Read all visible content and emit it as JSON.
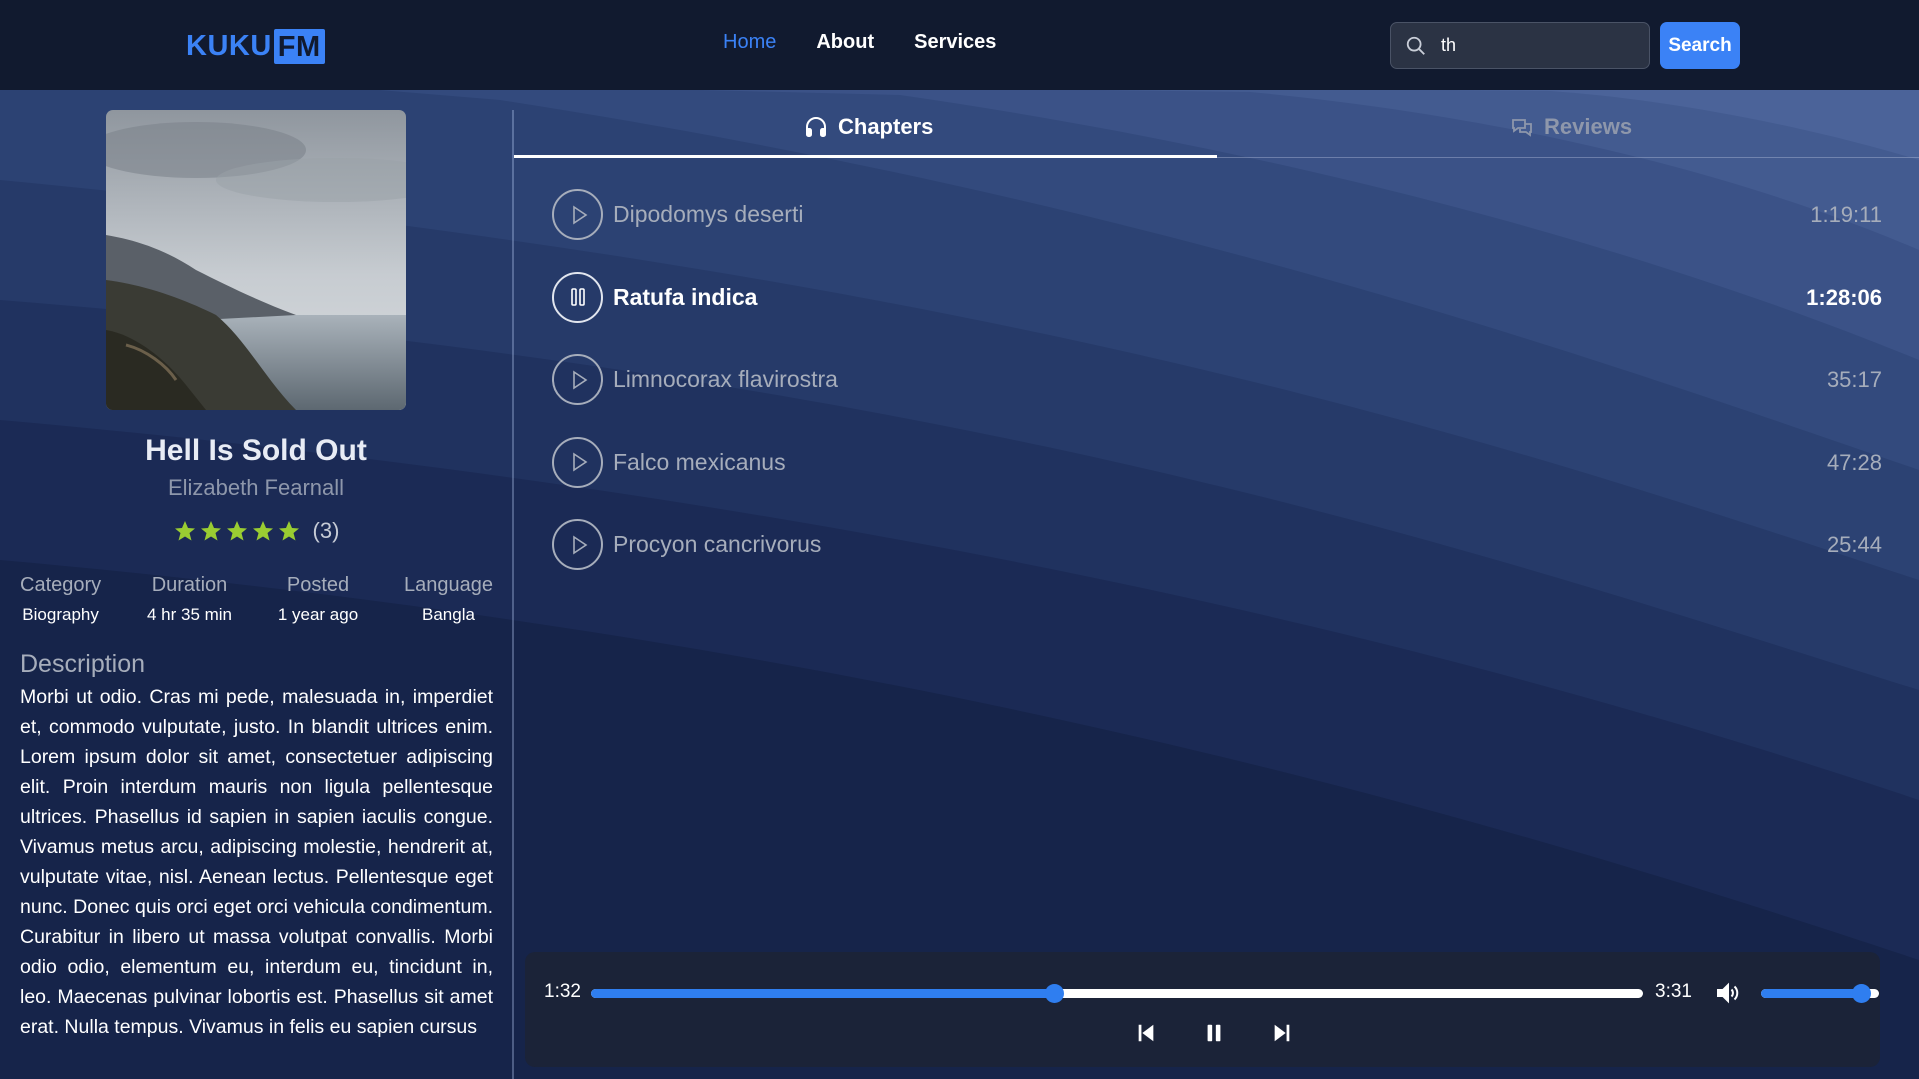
{
  "header": {
    "logo_part1": "KUKU",
    "logo_part2": "FM",
    "nav": [
      {
        "label": "Home",
        "active": true
      },
      {
        "label": "About",
        "active": false
      },
      {
        "label": "Services",
        "active": false
      }
    ],
    "search_value": "th",
    "search_button": "Search"
  },
  "book": {
    "title": "Hell Is Sold Out",
    "author": "Elizabeth Fearnall",
    "rating_stars": 5,
    "rating_count": "(3)",
    "meta": [
      {
        "key": "Category",
        "value": "Biography"
      },
      {
        "key": "Duration",
        "value": "4 hr 35 min"
      },
      {
        "key": "Posted",
        "value": "1 year ago"
      },
      {
        "key": "Language",
        "value": "Bangla"
      }
    ],
    "description_heading": "Description",
    "description": "Morbi ut odio. Cras mi pede, malesuada in, imperdiet et, commodo vulputate, justo. In blandit ultrices enim. Lorem ipsum dolor sit amet, consectetuer adipiscing elit. Proin interdum mauris non ligula pellentesque ultrices. Phasellus id sapien in sapien iaculis congue. Vivamus metus arcu, adipiscing molestie, hendrerit at, vulputate vitae, nisl. Aenean lectus. Pellentesque eget nunc. Donec quis orci eget orci vehicula condimentum. Curabitur in libero ut massa volutpat convallis. Morbi odio odio, elementum eu, interdum eu, tincidunt in, leo. Maecenas pulvinar lobortis est. Phasellus sit amet erat. Nulla tempus. Vivamus in felis eu sapien cursus"
  },
  "tabs": [
    {
      "label": "Chapters",
      "icon": "headphones-icon",
      "active": true
    },
    {
      "label": "Reviews",
      "icon": "chat-bubbles-icon",
      "active": false
    }
  ],
  "chapters": [
    {
      "name": "Dipodomys deserti",
      "duration": "1:19:11",
      "playing": false
    },
    {
      "name": "Ratufa indica",
      "duration": "1:28:06",
      "playing": true
    },
    {
      "name": "Limnocorax flavirostra",
      "duration": "35:17",
      "playing": false
    },
    {
      "name": "Falco mexicanus",
      "duration": "47:28",
      "playing": false
    },
    {
      "name": "Procyon cancrivorus",
      "duration": "25:44",
      "playing": false
    }
  ],
  "player": {
    "current_time": "1:32",
    "total_time": "3:31",
    "progress_fraction": 0.44,
    "volume_fraction": 0.85
  },
  "colors": {
    "accent": "#3b82f6",
    "header_bg": "#111a2f",
    "star": "#9acd32"
  }
}
